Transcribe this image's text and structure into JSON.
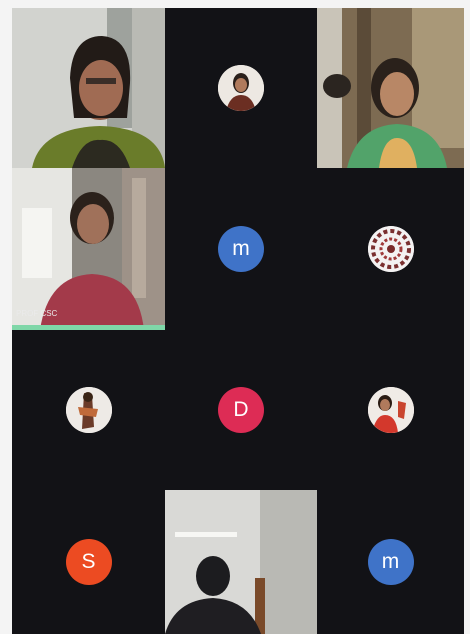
{
  "tiles": {
    "t4": {
      "name": "PROF CSC"
    },
    "t5": {
      "initial": "m"
    },
    "t8": {
      "initial": "D"
    },
    "t10": {
      "initial": "S"
    },
    "t12": {
      "initial": "m"
    }
  },
  "colors": {
    "grid_bg": "#101014",
    "avatar_blue": "#3f73c8",
    "avatar_pink": "#dd2c55",
    "avatar_orange": "#ec4b22",
    "active_speaker": "#7fd7a8"
  }
}
